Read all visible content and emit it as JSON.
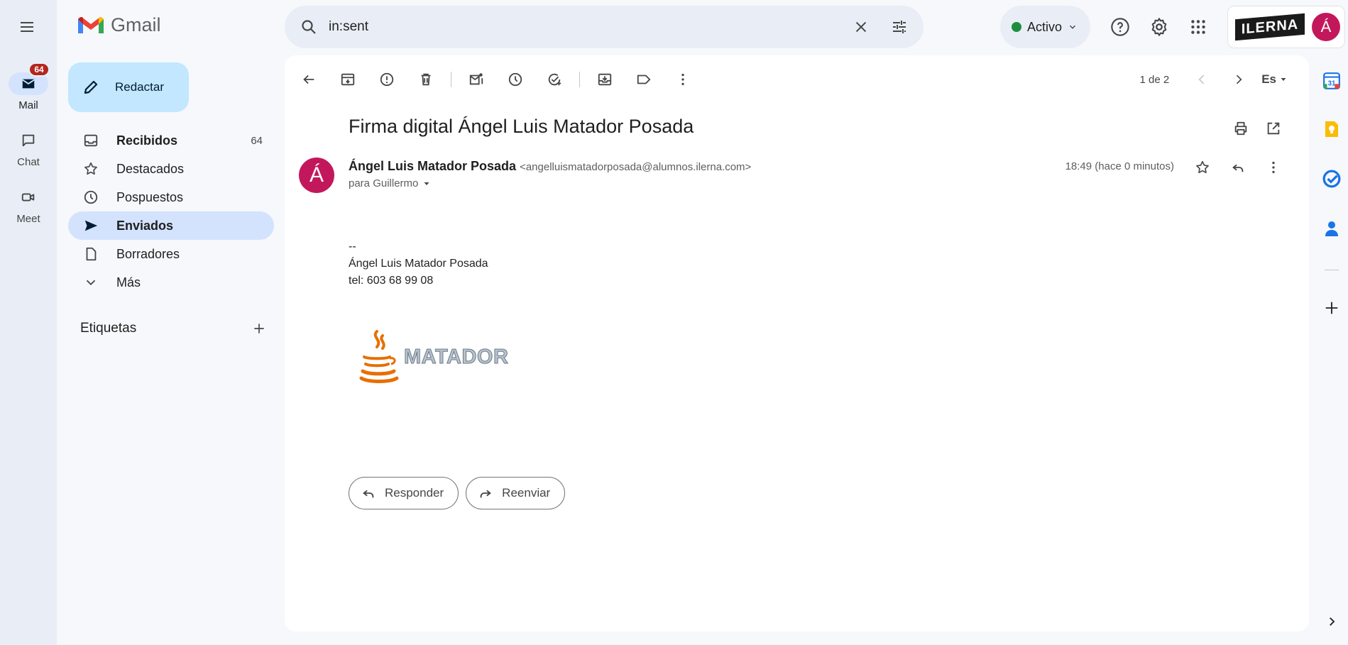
{
  "rail": {
    "items": [
      {
        "label": "Mail",
        "badge": "64"
      },
      {
        "label": "Chat"
      },
      {
        "label": "Meet"
      }
    ]
  },
  "app": {
    "name": "Gmail"
  },
  "compose": {
    "label": "Redactar"
  },
  "nav": {
    "items": [
      {
        "label": "Recibidos",
        "count": "64",
        "icon": "inbox-icon"
      },
      {
        "label": "Destacados",
        "icon": "star-icon"
      },
      {
        "label": "Pospuestos",
        "icon": "clock-icon"
      },
      {
        "label": "Enviados",
        "icon": "send-icon"
      },
      {
        "label": "Borradores",
        "icon": "draft-icon"
      },
      {
        "label": "Más",
        "icon": "chevron-down-icon"
      }
    ],
    "labels_title": "Etiquetas"
  },
  "search": {
    "value": "in:sent"
  },
  "status": {
    "label": "Activo",
    "color": "#1e8e3e"
  },
  "account": {
    "org": "ILERNA",
    "initial": "Á"
  },
  "pager": {
    "text": "1 de 2",
    "lang": "Es"
  },
  "message": {
    "subject": "Firma digital Ángel Luis Matador Posada",
    "sender_initial": "Á",
    "sender_name": "Ángel Luis Matador Posada",
    "sender_email": "<angelluismatadorposada@alumnos.ilerna.com>",
    "recipient": "para Guillermo",
    "time": "18:49 (hace 0 minutos)",
    "body": {
      "separator": "--",
      "name": "Ángel Luis Matador Posada",
      "phone": "tel: 603 68 99 08"
    },
    "signature_text": "MATADOR"
  },
  "actions": {
    "reply": "Responder",
    "forward": "Reenviar"
  },
  "colors": {
    "accent": "#0b57d0",
    "compose_bg": "#c2e7ff",
    "active_nav": "#d3e3fd",
    "avatar": "#c2185b"
  }
}
